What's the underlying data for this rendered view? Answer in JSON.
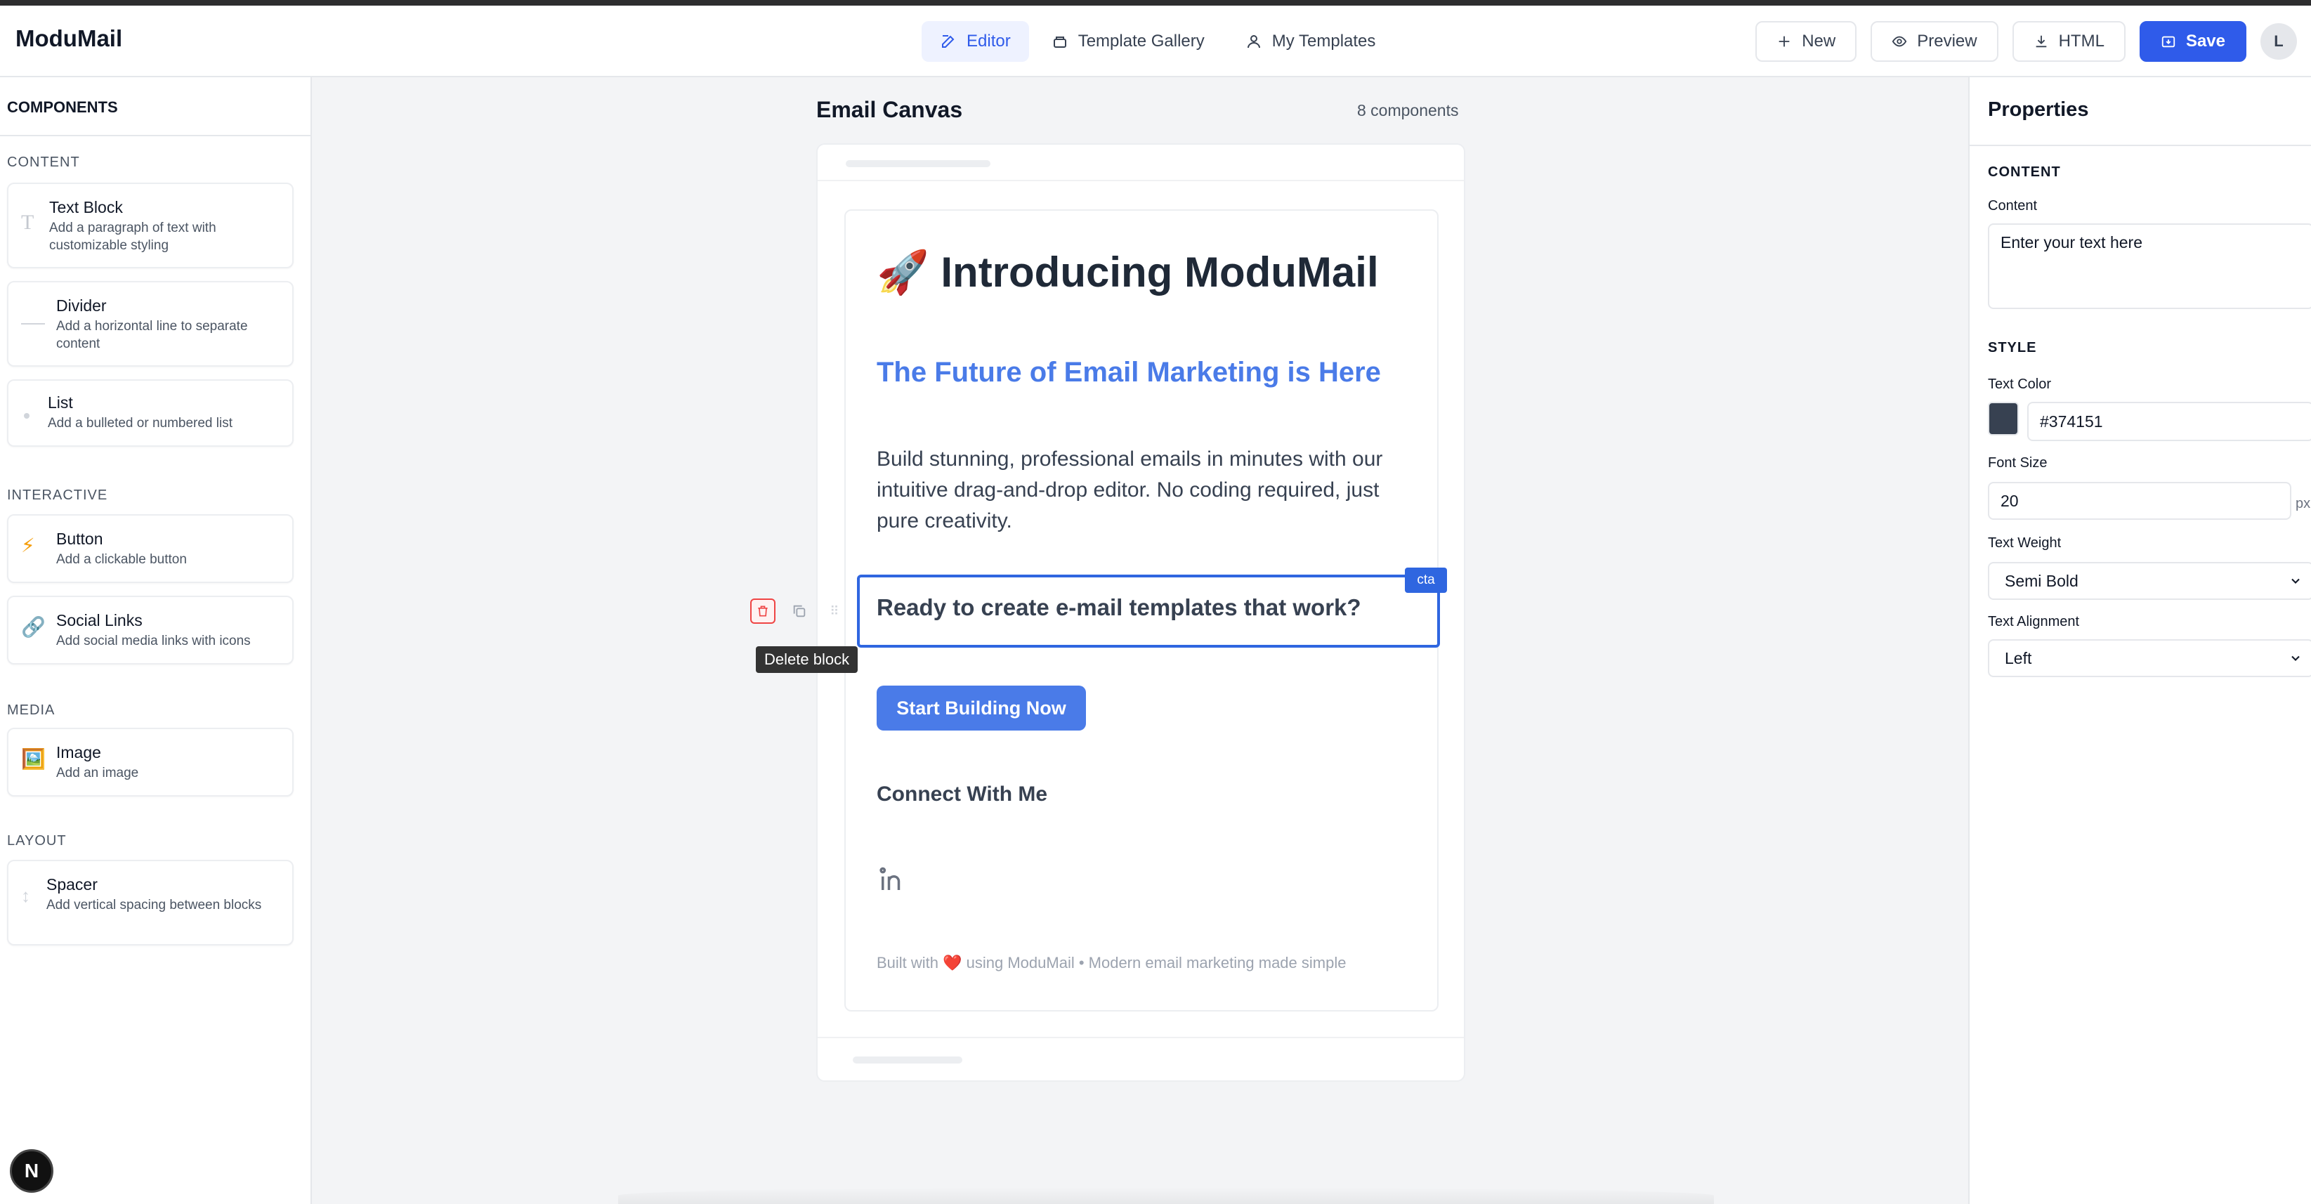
{
  "app": {
    "logo": "ModuMail"
  },
  "nav": [
    {
      "label": "Editor",
      "icon": "edit-icon",
      "active": true
    },
    {
      "label": "Template Gallery",
      "icon": "template-icon",
      "active": false
    },
    {
      "label": "My Templates",
      "icon": "user-icon",
      "active": false
    }
  ],
  "actions": {
    "new_label": "New",
    "preview_label": "Preview",
    "html_label": "HTML",
    "save_label": "Save",
    "avatar_initial": "L"
  },
  "sidebar": {
    "title": "COMPONENTS",
    "sections": [
      {
        "label": "CONTENT",
        "items": [
          {
            "name": "Text Block",
            "desc": "Add a paragraph of text with customizable styling",
            "icon": "text-icon"
          },
          {
            "name": "Divider",
            "desc": "Add a horizontal line to separate content",
            "icon": "divider-icon"
          },
          {
            "name": "List",
            "desc": "Add a bulleted or numbered list",
            "icon": "list-icon"
          }
        ]
      },
      {
        "label": "INTERACTIVE",
        "items": [
          {
            "name": "Button",
            "desc": "Add a clickable button",
            "icon": "lightning-icon"
          },
          {
            "name": "Social Links",
            "desc": "Add social media links with icons",
            "icon": "link-icon"
          }
        ]
      },
      {
        "label": "MEDIA",
        "items": [
          {
            "name": "Image",
            "desc": "Add an image",
            "icon": "image-icon"
          }
        ]
      },
      {
        "label": "LAYOUT",
        "items": [
          {
            "name": "Spacer",
            "desc": "Add vertical spacing between blocks",
            "icon": "spacer-icon"
          }
        ]
      }
    ]
  },
  "canvas": {
    "title": "Email Canvas",
    "count": "8 components",
    "email": {
      "title": "🚀 Introducing ModuMail",
      "subtitle": "The Future of Email Marketing is Here",
      "body": "Build stunning, professional emails in minutes with our intuitive drag-and-drop editor. No coding required, just pure creativity.",
      "cta_text": "Ready to create e-mail templates that work?",
      "cta_tag": "cta",
      "button_label": "Start Building Now",
      "connect": "Connect With Me",
      "footer": "Built with ❤️ using ModuMail • Modern email marketing made simple"
    },
    "tooltip": "Delete block"
  },
  "properties": {
    "title": "Properties",
    "content_section": "CONTENT",
    "content_label": "Content",
    "content_value": "Enter your text here",
    "style_section": "STYLE",
    "text_color_label": "Text Color",
    "text_color_value": "#374151",
    "font_size_label": "Font Size",
    "font_size_value": "20",
    "font_size_unit": "px",
    "weight_label": "Text Weight",
    "weight_value": "Semi Bold",
    "align_label": "Text Alignment",
    "align_value": "Left"
  },
  "colors": {
    "accent": "#2f5bea",
    "swatch": "#374151",
    "email_blue": "#4a7be8"
  }
}
